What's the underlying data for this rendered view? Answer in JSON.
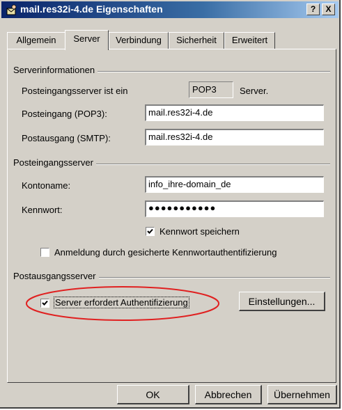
{
  "window": {
    "title": "mail.res32i-4.de Eigenschaften",
    "help_button": "?",
    "close_button": "X",
    "icon": "mail-account-icon"
  },
  "tabs": [
    {
      "label": "Allgemein",
      "active": false
    },
    {
      "label": "Server",
      "active": true
    },
    {
      "label": "Verbindung",
      "active": false
    },
    {
      "label": "Sicherheit",
      "active": false
    },
    {
      "label": "Erweitert",
      "active": false
    }
  ],
  "server_info": {
    "group_label": "Serverinformationen",
    "incoming_type_label": "Posteingangsserver ist ein",
    "incoming_type_value": "POP3",
    "incoming_type_suffix": "Server.",
    "incoming_label": "Posteingang (POP3):",
    "incoming_value": "mail.res32i-4.de",
    "outgoing_label": "Postausgang (SMTP):",
    "outgoing_value": "mail.res32i-4.de"
  },
  "incoming_server": {
    "group_label": "Posteingangsserver",
    "account_label": "Kontoname:",
    "account_value": "info_ihre-domain_de",
    "password_label": "Kennwort:",
    "password_value": "●●●●●●●●●●●",
    "remember_password_label": "Kennwort speichern",
    "remember_password_checked": true,
    "spa_label": "Anmeldung durch gesicherte Kennwortauthentifizierung",
    "spa_checked": false
  },
  "outgoing_server": {
    "group_label": "Postausgangsserver",
    "auth_label": "Server erfordert Authentifizierung",
    "auth_checked": true,
    "settings_button": "Einstellungen..."
  },
  "footer": {
    "ok": "OK",
    "cancel": "Abbrechen",
    "apply": "Übernehmen"
  },
  "annotation_color": "#e02020"
}
